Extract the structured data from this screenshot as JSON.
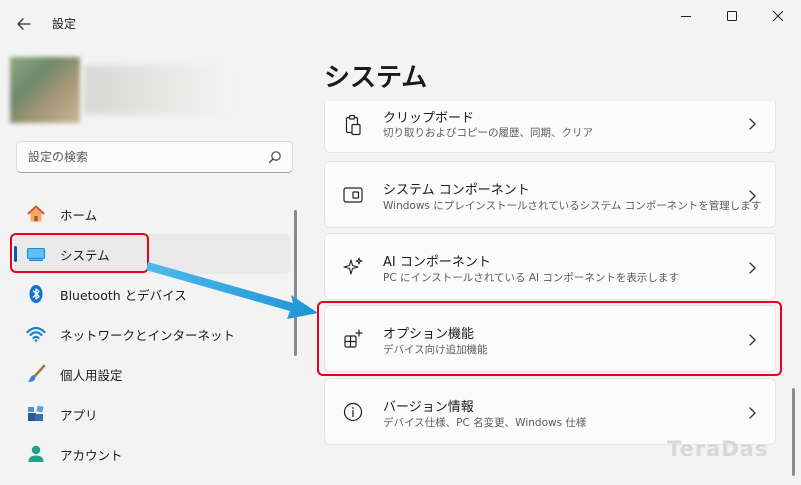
{
  "window": {
    "title": "設定",
    "back_icon": "arrow-left-icon",
    "controls": [
      "minimize-icon",
      "maximize-icon",
      "close-icon"
    ]
  },
  "sidebar": {
    "search": {
      "placeholder": "設定の検索",
      "value": ""
    },
    "items": [
      {
        "label": "ホーム",
        "icon": "home-icon",
        "selected": false
      },
      {
        "label": "システム",
        "icon": "monitor-icon",
        "selected": true
      },
      {
        "label": "Bluetooth とデバイス",
        "icon": "bluetooth-icon",
        "selected": false
      },
      {
        "label": "ネットワークとインターネット",
        "icon": "wifi-icon",
        "selected": false
      },
      {
        "label": "個人用設定",
        "icon": "paintbrush-icon",
        "selected": false
      },
      {
        "label": "アプリ",
        "icon": "apps-icon",
        "selected": false
      },
      {
        "label": "アカウント",
        "icon": "account-icon",
        "selected": false
      }
    ]
  },
  "main": {
    "title": "システム",
    "cards": [
      {
        "title": "クリップボード",
        "subtitle": "切り取りおよびコピーの履歴、同期、クリア",
        "icon": "clipboard-icon"
      },
      {
        "title": "システム コンポーネント",
        "subtitle": "Windows にプレインストールされているシステム コンポーネントを管理します",
        "icon": "system-component-icon"
      },
      {
        "title": "AI コンポーネント",
        "subtitle": "PC にインストールされている AI コンポーネントを表示します",
        "icon": "sparkle-icon"
      },
      {
        "title": "オプション機能",
        "subtitle": "デバイス向け追加機能",
        "icon": "optional-features-icon"
      },
      {
        "title": "バージョン情報",
        "subtitle": "デバイス仕様、PC 名変更、Windows 仕様",
        "icon": "info-icon"
      }
    ]
  },
  "watermark": "TeraDas",
  "colors": {
    "accent": "#005fb8",
    "highlight": "#e8001c",
    "arrow": "#29a3e0"
  }
}
